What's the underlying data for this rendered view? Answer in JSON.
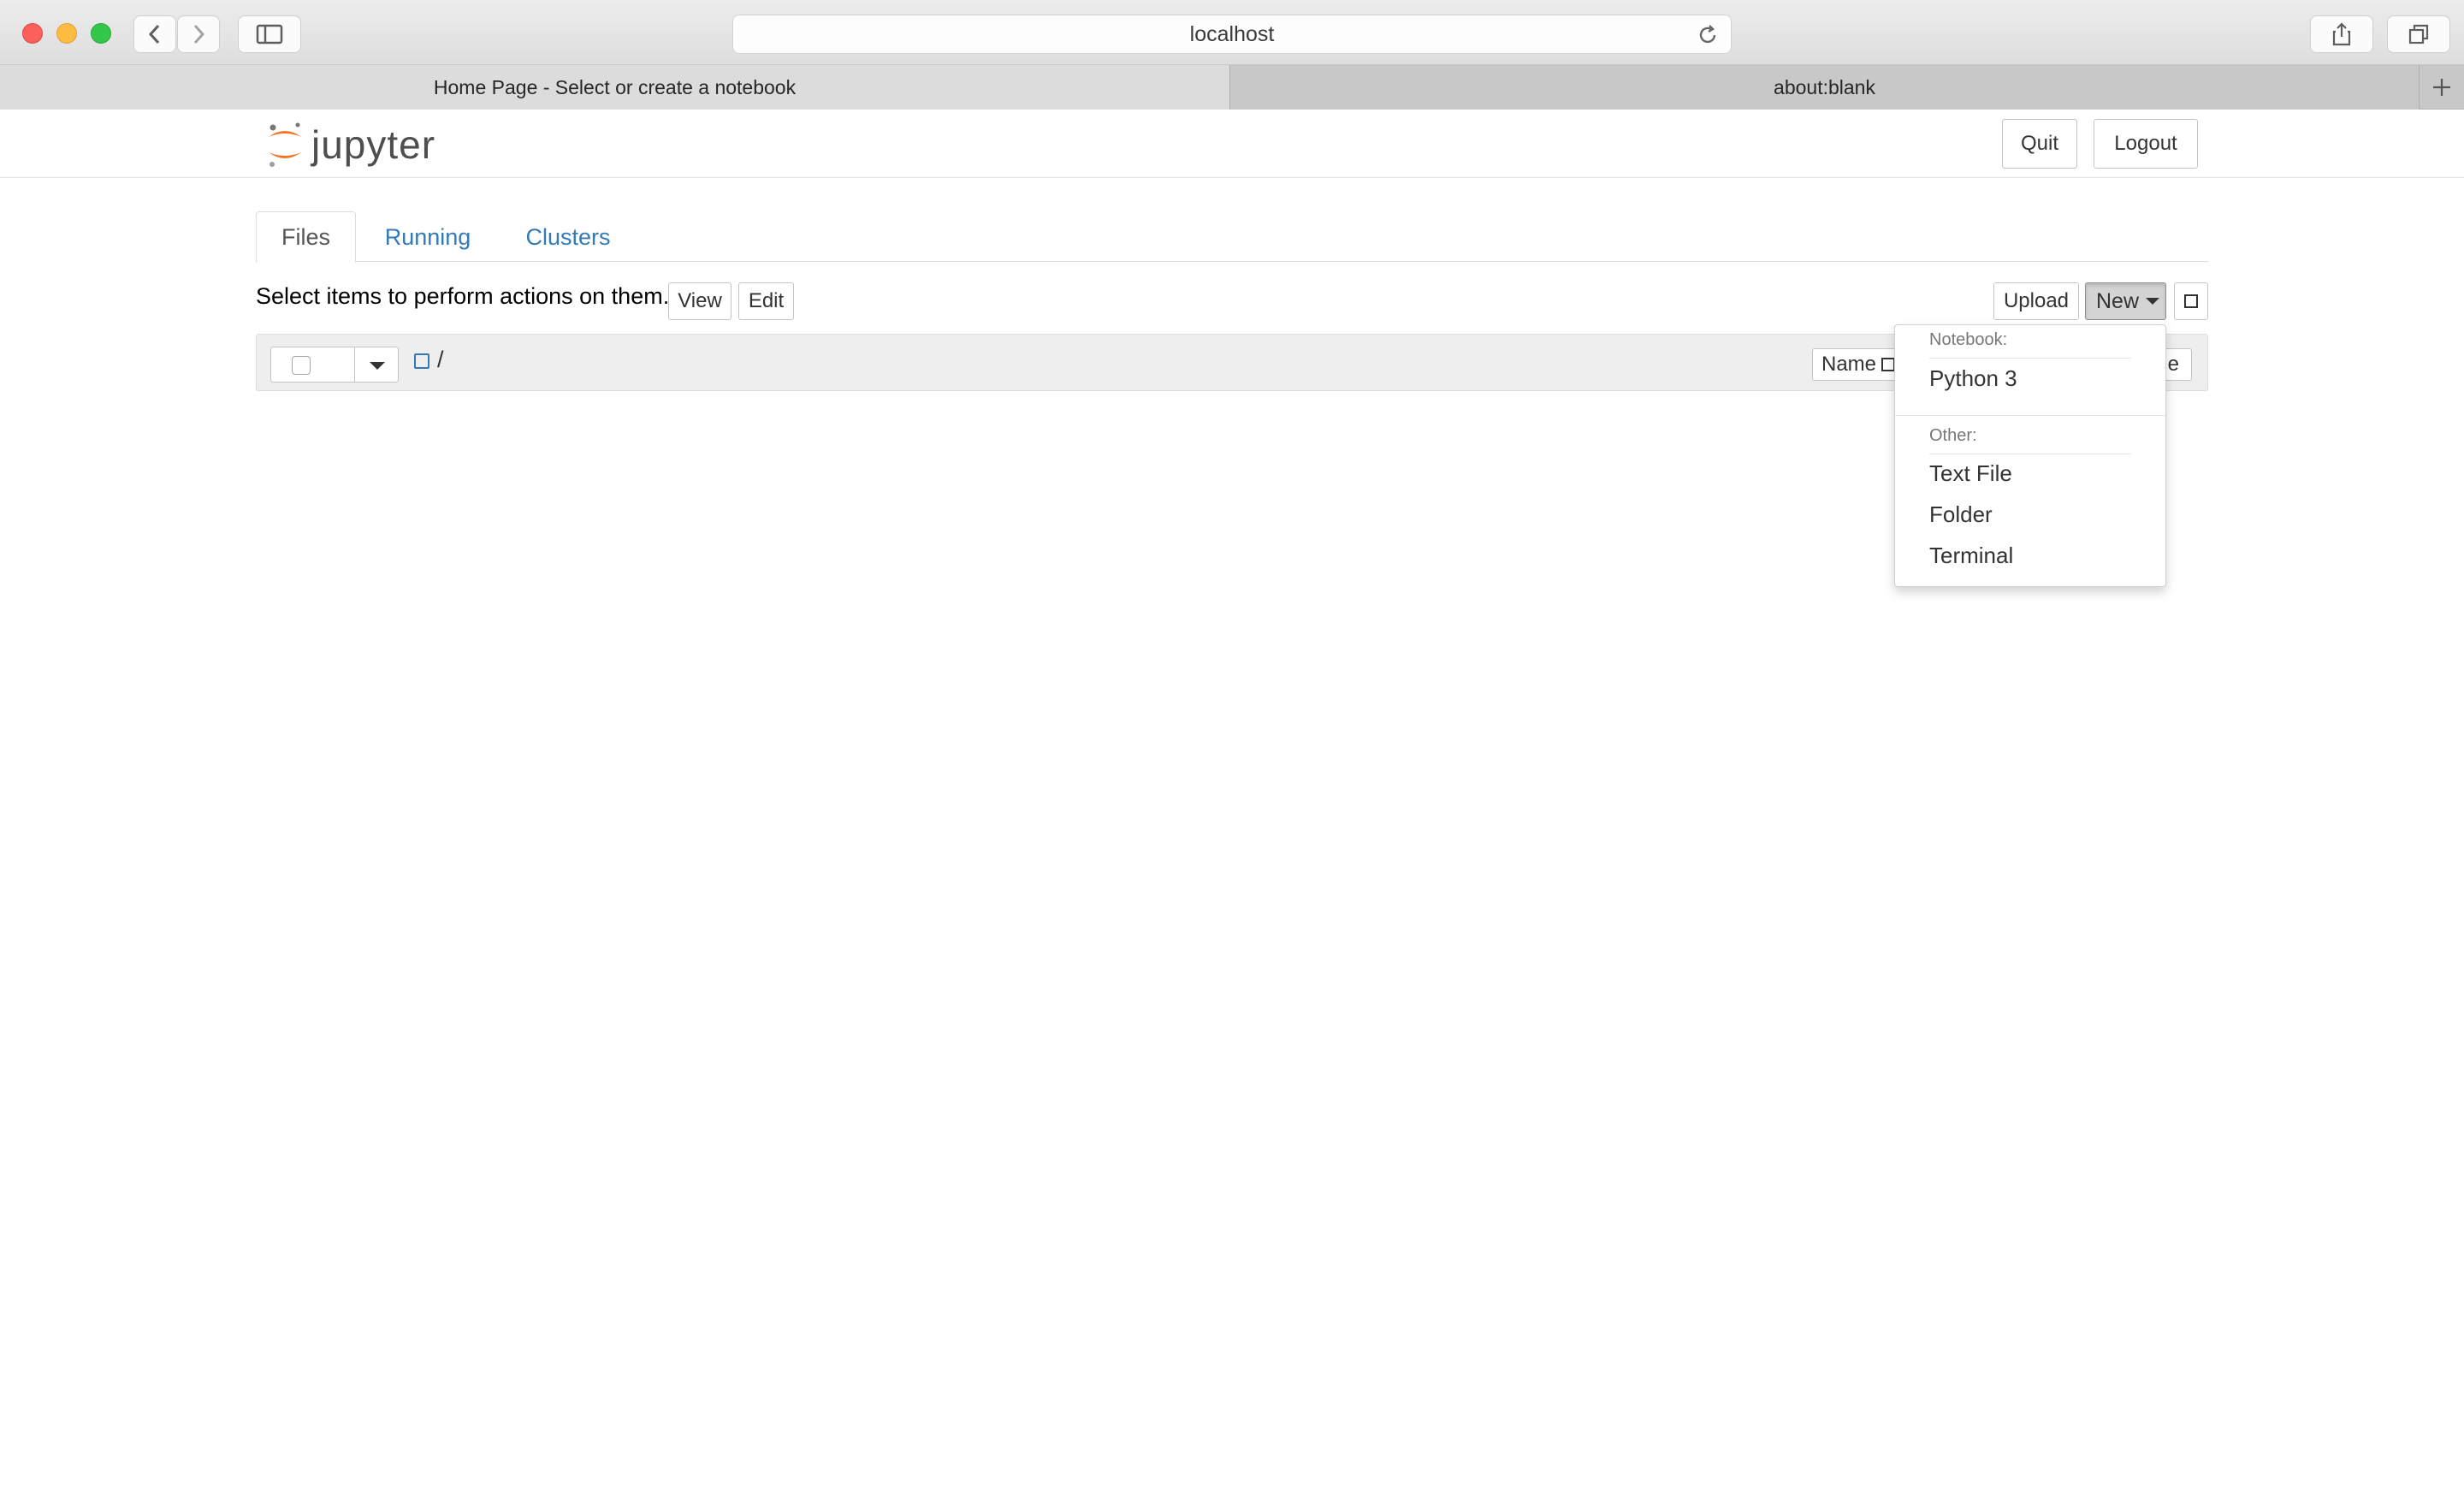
{
  "browser": {
    "address": "localhost",
    "tabs": [
      {
        "title": "Home Page - Select or create a notebook",
        "active": true
      },
      {
        "title": "about:blank",
        "active": false
      }
    ],
    "icons": [
      "back-icon",
      "forward-icon",
      "sidebar-icon",
      "reload-icon",
      "share-icon",
      "tabs-overview-icon",
      "plus-icon"
    ]
  },
  "header": {
    "logo_text": "jupyter",
    "quit_label": "Quit",
    "logout_label": "Logout"
  },
  "tabs": [
    {
      "label": "Files"
    },
    {
      "label": "Running"
    },
    {
      "label": "Clusters"
    }
  ],
  "toolbar": {
    "hint": "Select items to perform actions on them.",
    "view_label": "View",
    "edit_label": "Edit",
    "upload_label": "Upload",
    "new_label": "New"
  },
  "list_header": {
    "breadcrumb": "/",
    "name_label": "Name",
    "partial_label": "e"
  },
  "new_menu": {
    "notebook_header": "Notebook:",
    "notebook_items": [
      "Python 3"
    ],
    "other_header": "Other:",
    "other_items": [
      "Text File",
      "Folder",
      "Terminal"
    ]
  },
  "colors": {
    "link": "#337ab7",
    "logo_orange": "#f37626"
  }
}
